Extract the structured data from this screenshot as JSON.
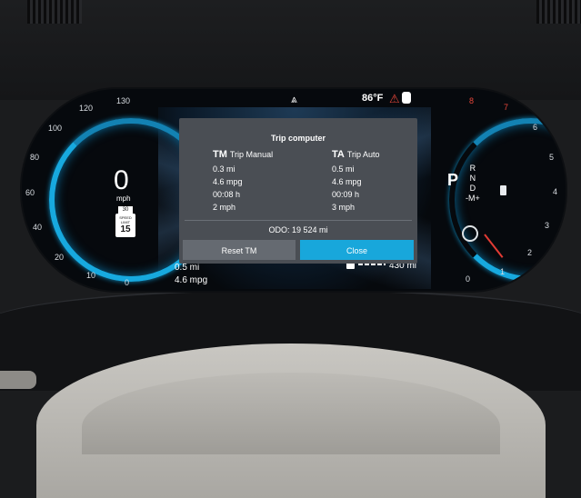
{
  "top_status": {
    "temperature": "86°F"
  },
  "speedometer": {
    "speed": "0",
    "unit": "mph",
    "ticks": [
      "10",
      "20",
      "40",
      "60",
      "80",
      "100",
      "120",
      "130",
      "0"
    ],
    "limit_sign_text": "SPEED LIMIT",
    "limit_value": "15",
    "supplementary_sign": "30"
  },
  "rpm_gauge": {
    "ticks": [
      "8",
      "7",
      "6",
      "5",
      "4",
      "3",
      "2",
      "1",
      "0"
    ],
    "gear_selected": "P",
    "gear_options": [
      "R",
      "N",
      "D",
      "-M+"
    ]
  },
  "bottom_info": {
    "trip_distance": "0.5 mi",
    "trip_consumption": "4.6 mpg",
    "range": "430 mi"
  },
  "trip_computer": {
    "title": "Trip computer",
    "tm_abbr": "TM",
    "tm_label": "Trip Manual",
    "tm_distance": "0.3 mi",
    "tm_consumption": "4.6 mpg",
    "tm_time": "00:08 h",
    "tm_speed": "2 mph",
    "ta_abbr": "TA",
    "ta_label": "Trip Auto",
    "ta_distance": "0.5 mi",
    "ta_consumption": "4.6 mpg",
    "ta_time": "00:09 h",
    "ta_speed": "3 mph",
    "odo": "ODO:  19 524 mi",
    "reset_label": "Reset TM",
    "close_label": "Close"
  }
}
